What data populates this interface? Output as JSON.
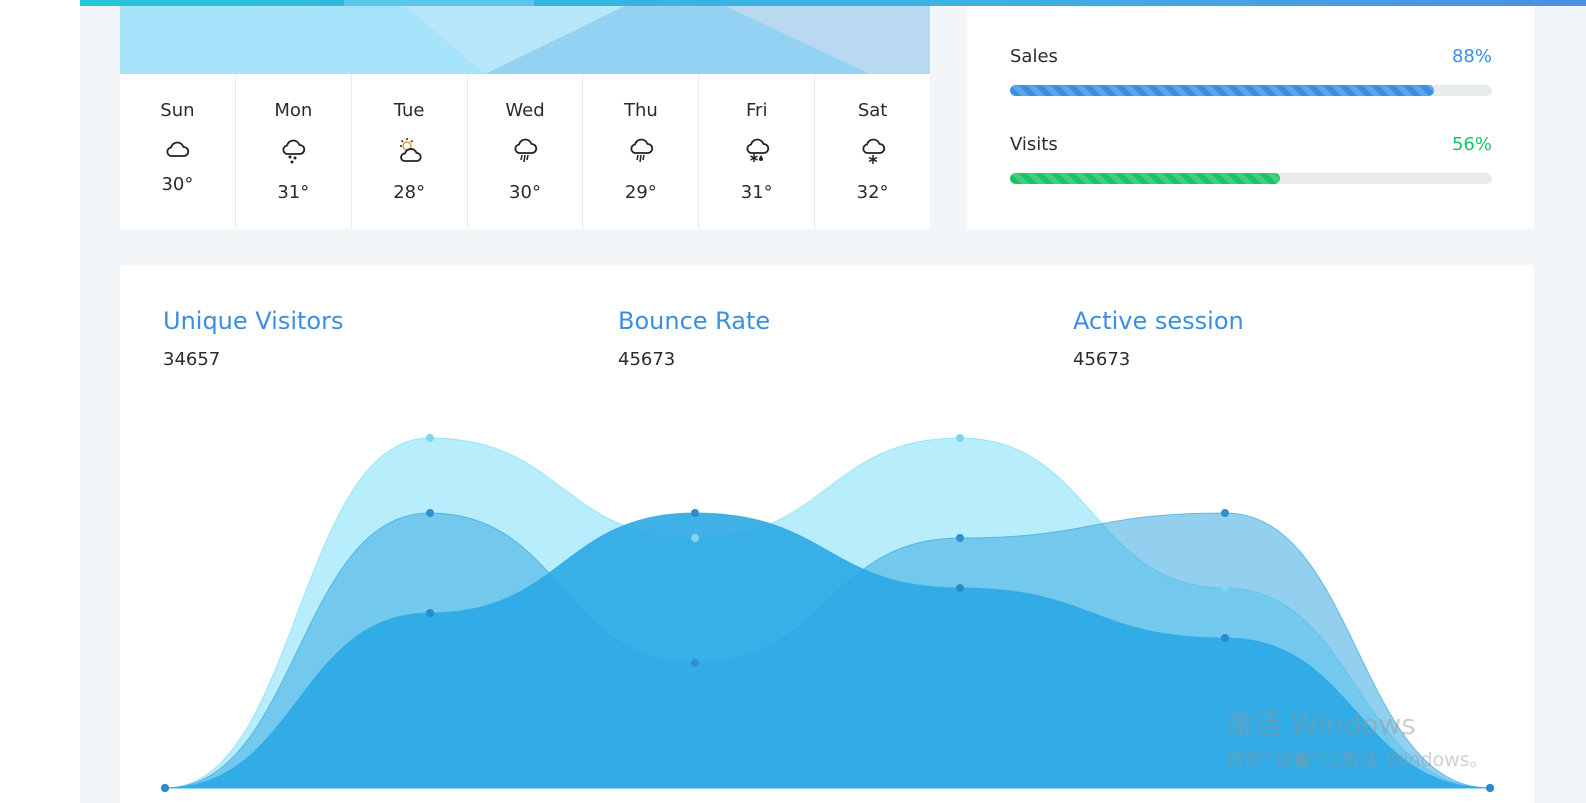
{
  "theme": {
    "accent": "#3a8fe0",
    "success": "#17c365"
  },
  "weather": {
    "days": [
      {
        "name": "Sun",
        "temp": "30°",
        "icon": "cloud-icon"
      },
      {
        "name": "Mon",
        "temp": "31°",
        "icon": "hail-icon"
      },
      {
        "name": "Tue",
        "temp": "28°",
        "icon": "partly-cloudy-day-icon"
      },
      {
        "name": "Wed",
        "temp": "30°",
        "icon": "rain-icon"
      },
      {
        "name": "Thu",
        "temp": "29°",
        "icon": "rain-icon"
      },
      {
        "name": "Fri",
        "temp": "31°",
        "icon": "snow-sleet-icon"
      },
      {
        "name": "Sat",
        "temp": "32°",
        "icon": "snow-icon"
      }
    ]
  },
  "progress": {
    "sales": {
      "label": "Sales",
      "value_text": "88%",
      "fraction": 0.88,
      "color": "#3a8fe0"
    },
    "visits": {
      "label": "Visits",
      "value_text": "56%",
      "fraction": 0.56,
      "color": "#17c365"
    }
  },
  "stats": [
    {
      "title": "Unique Visitors",
      "value": "34657"
    },
    {
      "title": "Bounce Rate",
      "value": "45673"
    },
    {
      "title": "Active session",
      "value": "45673"
    }
  ],
  "chart_data": {
    "type": "area",
    "x": [
      0,
      1,
      2,
      3,
      4,
      5
    ],
    "series": [
      {
        "values": [
          0,
          70,
          50,
          70,
          40,
          0
        ],
        "color": "#7ddff8"
      },
      {
        "values": [
          0,
          55,
          25,
          50,
          55,
          0
        ],
        "color": "#3aa9e2"
      },
      {
        "values": [
          0,
          35,
          55,
          40,
          30,
          0
        ],
        "color": "#2aa8e4"
      }
    ],
    "ylim": [
      0,
      70
    ],
    "grid": false,
    "legend": "none"
  },
  "watermark": {
    "line1": "激活 Windows",
    "line2": "转到“设置”以激活 Windows。"
  }
}
